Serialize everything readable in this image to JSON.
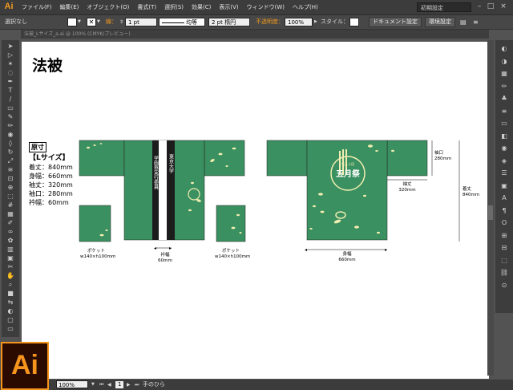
{
  "app": {
    "logo": "Ai",
    "workspace": "初期設定"
  },
  "menu": [
    "ファイル(F)",
    "編集(E)",
    "オブジェクト(O)",
    "書式(T)",
    "選択(S)",
    "効果(C)",
    "表示(V)",
    "ウィンドウ(W)",
    "ヘルプ(H)"
  ],
  "options": {
    "selection": "選択なし",
    "stroke_label": "線：",
    "stroke_weight": "1 pt",
    "profile": "均等",
    "brush": "2 pt 楕円",
    "opacity_label": "不透明度：",
    "opacity": "100%",
    "style_label": "スタイル：",
    "doc_setup": "ドキュメント設定",
    "prefs": "環境設定"
  },
  "tab": {
    "name": "法被_Lサイズ_a.ai @ 100% (CMYK/プレビュー)"
  },
  "artboard": {
    "title": "法被",
    "dims_head": "原寸",
    "size_name": "【Lサイズ】",
    "specs": [
      "着丈：840mm",
      "身幅：660mm",
      "袖丈：320mm",
      "袖口：280mm",
      "衿幅：60mm"
    ],
    "front_collar_left": "東京大学",
    "front_collar_right": "学園祭実行委員",
    "back_logo_main": "五月祭",
    "back_logo_small": "第九十回",
    "pocket_label_1": "ポケット",
    "pocket_size_1": "w140×h100mm",
    "pocket_label_2": "ポケット",
    "pocket_size_2": "w140×h100mm",
    "collar_label": "衿幅",
    "collar_size": "60mm",
    "sleeve_length_label": "袖丈",
    "sleeve_length_size": "320mm",
    "cuff_label": "袖口",
    "cuff_size": "280mm",
    "body_width_label": "身幅",
    "body_width_size": "660mm",
    "length_label": "着丈",
    "length_size": "840mm"
  },
  "status": {
    "zoom": "100%",
    "page": "1",
    "tool": "手のひら"
  },
  "colors": {
    "happi_green": "#3a9060",
    "collar_black": "#1c1c1c",
    "accent_orange": "#f7941d",
    "leaf_yellow": "#f1edb0"
  },
  "tools": [
    "selection-icon",
    "direct-selection-icon",
    "magic-wand-icon",
    "lasso-icon",
    "pen-icon",
    "type-icon",
    "line-icon",
    "rectangle-icon",
    "paintbrush-icon",
    "pencil-icon",
    "blob-brush-icon",
    "eraser-icon",
    "rotate-icon",
    "scale-icon",
    "width-icon",
    "free-transform-icon",
    "shape-builder-icon",
    "perspective-icon",
    "mesh-icon",
    "gradient-icon",
    "eyedropper-icon",
    "blend-icon",
    "symbol-sprayer-icon",
    "graph-icon",
    "artboard-icon",
    "slice-icon",
    "hand-icon",
    "zoom-icon",
    "fill-stroke-icon",
    "swap-icon",
    "color-mode-icon",
    "draw-mode-icon",
    "screen-mode-icon"
  ],
  "panels": [
    "color-icon",
    "color-guide-icon",
    "swatches-icon",
    "brushes-icon",
    "symbols-icon",
    "stroke-icon",
    "gradient-panel-icon",
    "transparency-icon",
    "appearance-icon",
    "graphic-styles-icon",
    "layers-icon",
    "artboards-icon",
    "character-icon",
    "paragraph-icon",
    "opentype-icon",
    "align-icon",
    "pathfinder-icon",
    "transform-icon",
    "links-icon",
    "navigator-icon"
  ]
}
